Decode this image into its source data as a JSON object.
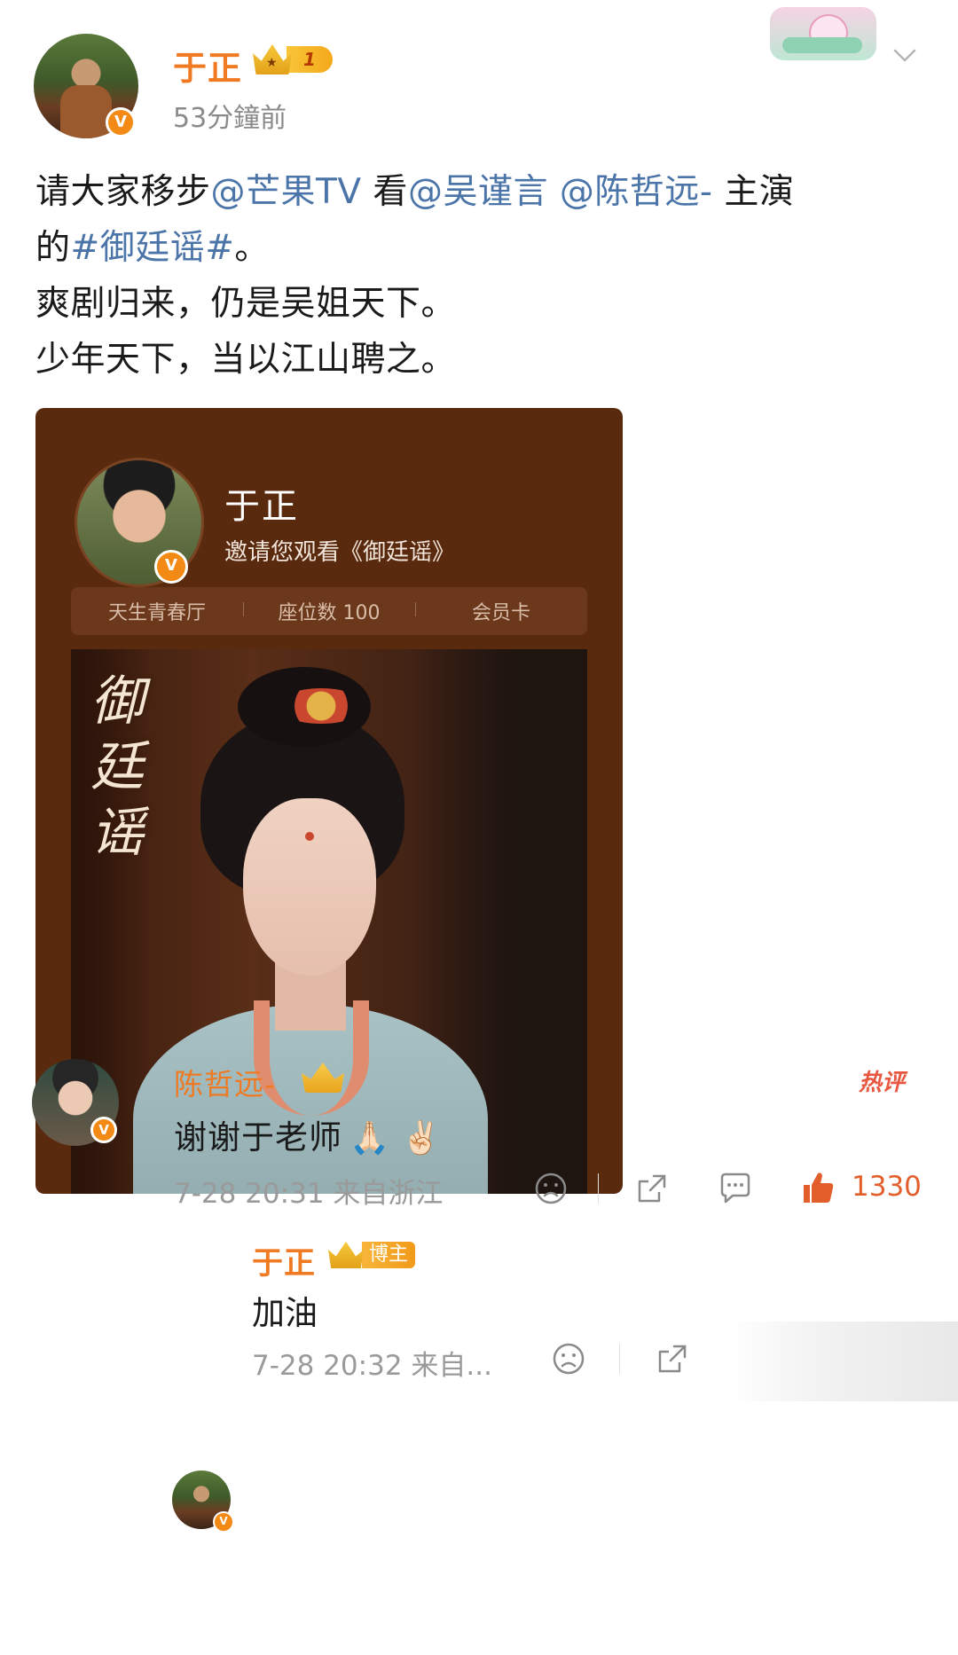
{
  "post": {
    "author": "于正",
    "level": "1",
    "time": "53分鐘前",
    "text": {
      "line1_a": "请大家移步",
      "mention1": "@芒果TV",
      "line1_b": " 看",
      "mention2": "@吴谨言",
      "mention3": "@陈哲远-",
      "line1_c": " 主演",
      "line2_a": "的",
      "hashtag": "#御廷谣#",
      "line2_b": "。",
      "line3": "爽剧归来，仍是吴姐天下。",
      "line4": "少年天下，当以江山聘之。"
    }
  },
  "card": {
    "name": "于正",
    "subtitle": "邀请您观看《御廷谣》",
    "info": [
      "天生青春厅",
      "座位数 100",
      "会员卡"
    ],
    "poster_title": "御廷谣"
  },
  "comment": {
    "author": "陈哲远-",
    "hot_tag": "热评",
    "text": "谢谢于老师",
    "emoji": "🙏🏻 ✌🏻",
    "time": "7-28 20:31 来自浙江",
    "likes": "1330"
  },
  "reply": {
    "author": "于正",
    "badge": "博主",
    "text": "加油",
    "time": "7-28 20:32 来自..."
  },
  "colors": {
    "accent": "#f07a22",
    "link": "#4b74a8",
    "card_bg": "#5a2a0e",
    "like": "#e25f2c"
  },
  "icons": {
    "verified": "verified-v-icon",
    "more": "chevron-down-icon",
    "dislike": "sad-face-icon",
    "share": "share-icon",
    "comment": "comment-bubble-icon",
    "like": "thumbs-up-icon"
  }
}
